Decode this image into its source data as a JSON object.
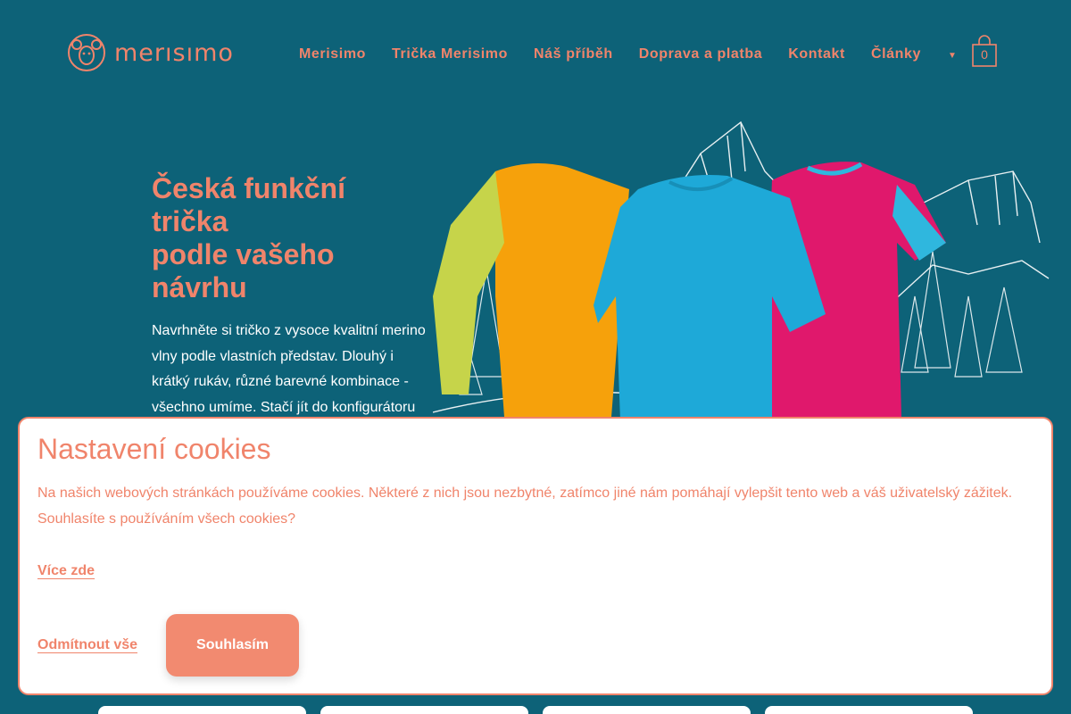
{
  "header": {
    "logo_text": "merısımo",
    "nav": [
      {
        "label": "Merisimo"
      },
      {
        "label": "Trička Merisimo"
      },
      {
        "label": "Náš příběh"
      },
      {
        "label": "Doprava a platba"
      },
      {
        "label": "Kontakt"
      },
      {
        "label": "Články"
      }
    ],
    "dropdown_icon": "triangle-down-icon",
    "cart_count": "0",
    "cart_icon": "shopping-bag-icon"
  },
  "hero": {
    "title_lines": [
      "Česká funkční",
      "trička",
      "podle vašeho",
      "návrhu"
    ],
    "text": "Navrhněte si tričko z vysoce kvalitní merino vlny podle vlastních představ. Dlouhý i krátký rukáv, různé barevné kombinace - všechno umíme. Stačí jít do konfigurátoru"
  },
  "cookie": {
    "title": "Nastavení cookies",
    "text": "Na našich webových stránkách používáme cookies. Některé z nich jsou nezbytné, zatímco jiné nám pomáhají vylepšit tento web a váš uživatelský zážitek. Souhlasíte s používáním všech cookies?",
    "more_link": "Více zde",
    "reject_label": "Odmítnout vše",
    "accept_label": "Souhlasím"
  },
  "colors": {
    "background": "#0d6278",
    "accent": "#f0846b",
    "button": "#f28a70"
  }
}
